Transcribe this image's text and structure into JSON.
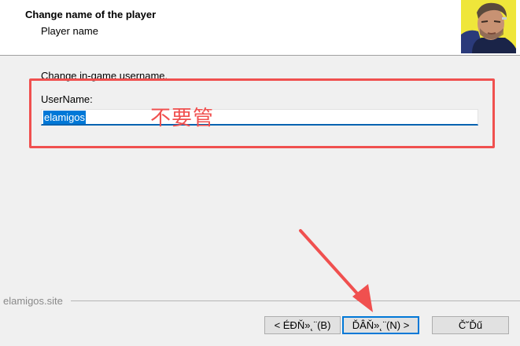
{
  "header": {
    "title": "Change name of the player",
    "subtitle": "Player name"
  },
  "main": {
    "instruction": "Change in-game username.",
    "field_label": "UserName:",
    "field_value": "elamigos"
  },
  "annotation": {
    "text": "不要管",
    "color": "#f0504f"
  },
  "footer": {
    "brand": "elamigos.site",
    "buttons": {
      "back": "< ÉĐŇ»˛¨(B)",
      "next": "ĎÂŇ»˛¨(N) >",
      "cancel": "Č˘Ďű"
    }
  },
  "icons": {
    "header_image": "game-character-portrait"
  },
  "colors": {
    "accent": "#0078d7",
    "annotation_red": "#f0504f"
  }
}
